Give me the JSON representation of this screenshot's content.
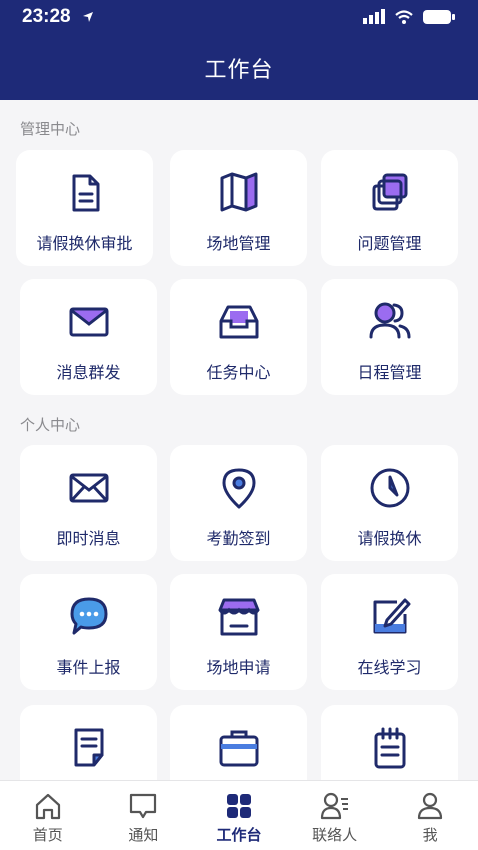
{
  "status": {
    "time": "23:28"
  },
  "header": {
    "title": "工作台"
  },
  "sections": {
    "management": {
      "label": "管理中心",
      "items": [
        "请假换休审批",
        "场地管理",
        "问题管理",
        "消息群发",
        "任务中心",
        "日程管理"
      ]
    },
    "personal": {
      "label": "个人中心",
      "items": [
        "即时消息",
        "考勤签到",
        "请假换休",
        "事件上报",
        "场地申请",
        "在线学习"
      ]
    }
  },
  "tabs": [
    "首页",
    "通知",
    "工作台",
    "联络人",
    "我"
  ],
  "active_tab": "工作台",
  "colors": {
    "primary": "#1e2a78",
    "accent": "#9b6cf0",
    "background": "#f5f5f7"
  }
}
